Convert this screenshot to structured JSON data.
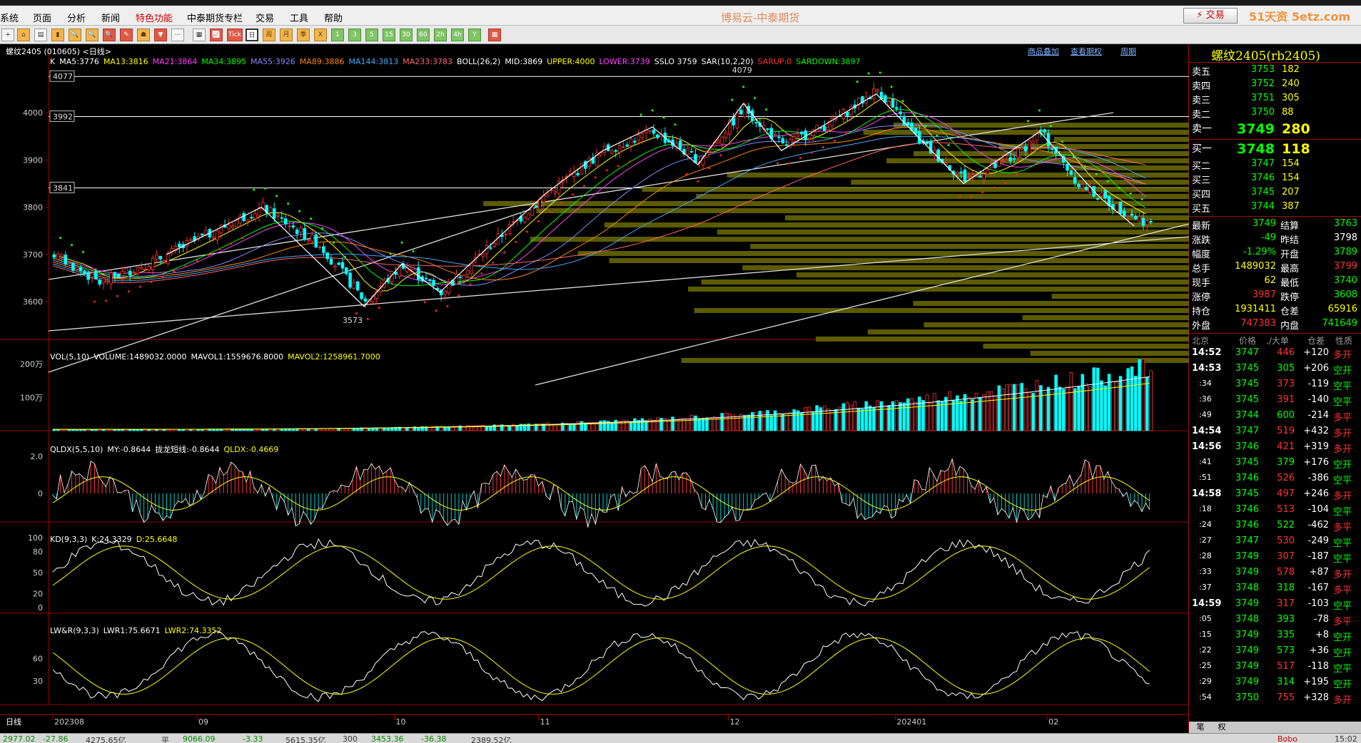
{
  "menu": [
    "系统",
    "页面",
    "分析",
    "新闻",
    "特色功能",
    "中泰期货专栏",
    "交易",
    "工具",
    "帮助"
  ],
  "app_title": "博易云-中泰期货",
  "trade_button": "⚡ 交易",
  "watermark": "51天资 5etz.com",
  "toolbar_labels": [
    "+",
    "⌂",
    "▤",
    "▮",
    "🔍",
    "🔍",
    "🔍",
    "✎",
    "☗",
    "▼",
    "⋯",
    "▦",
    "📈",
    "Tick",
    "日",
    "周",
    "月",
    "季",
    "X",
    "1",
    "3",
    "5",
    "15",
    "30",
    "60",
    "2h",
    "4h",
    "Y",
    "▦"
  ],
  "chart": {
    "instrument_label": "螺纹2405 (010605) <日线>",
    "links": [
      "商品叠加",
      "查看期权",
      "周期"
    ],
    "ma_legend": [
      {
        "text": "K",
        "color": "#ffffff"
      },
      {
        "text": "MA5:3776",
        "color": "#ffffff"
      },
      {
        "text": "MA13:3816",
        "color": "#ffff00"
      },
      {
        "text": "MA21:3864",
        "color": "#ff44ff"
      },
      {
        "text": "MA34:3895",
        "color": "#00ff00"
      },
      {
        "text": "MA55:3926",
        "color": "#8888ff"
      },
      {
        "text": "MA89:3886",
        "color": "#ff8800"
      },
      {
        "text": "MA144:3813",
        "color": "#44aaff"
      },
      {
        "text": "MA233:3783",
        "color": "#ff6666"
      },
      {
        "text": "BOLL(26,2)",
        "color": "#ffffff"
      },
      {
        "text": "MID:3869",
        "color": "#ffffff"
      },
      {
        "text": "UPPER:4000",
        "color": "#ffff00"
      },
      {
        "text": "LOWER:3739",
        "color": "#ff44ff"
      },
      {
        "text": "SSLO 3759",
        "color": "#ffffff"
      },
      {
        "text": "SAR(10,2,20)",
        "color": "#ffffff"
      },
      {
        "text": "SARUP:0",
        "color": "#ff3333"
      },
      {
        "text": "SARDOWN:3897",
        "color": "#00ff00"
      }
    ],
    "price_axis": [
      "4000",
      "3900",
      "3800",
      "3700",
      "3600"
    ],
    "price_boxes": [
      "4077",
      "3992",
      "3841"
    ],
    "annotations": [
      "4079",
      "3573"
    ],
    "vol_legend": [
      {
        "text": "VOL(5,10)",
        "color": "#ffffff"
      },
      {
        "text": "VOLUME:1489032.0000",
        "color": "#ffffff"
      },
      {
        "text": "MAVOL1:1559676.8000",
        "color": "#ffffff"
      },
      {
        "text": "MAVOL2:1258961.7000",
        "color": "#ffff00"
      }
    ],
    "vol_axis": [
      "200万",
      "100万"
    ],
    "qldx_legend": [
      {
        "text": "QLDX(5,5,10)",
        "color": "#ffffff"
      },
      {
        "text": "MY:-0.8644",
        "color": "#ffffff"
      },
      {
        "text": "拢龙短线:-0.8644",
        "color": "#ffffff"
      },
      {
        "text": "QLDX:-0.4669",
        "color": "#ffff00"
      }
    ],
    "qldx_axis": [
      "2.0",
      "0"
    ],
    "kd_legend": [
      {
        "text": "KD(9,3,3)",
        "color": "#ffffff"
      },
      {
        "text": "K:24.3329",
        "color": "#ffffff"
      },
      {
        "text": "D:25.6648",
        "color": "#ffff00"
      }
    ],
    "kd_axis": [
      "100",
      "80",
      "50",
      "20",
      "0"
    ],
    "lwr_legend": [
      {
        "text": "LW&R(9,3,3)",
        "color": "#ffffff"
      },
      {
        "text": "LWR1:75.6671",
        "color": "#ffffff"
      },
      {
        "text": "LWR2:74.3352",
        "color": "#ffff00"
      }
    ],
    "lwr_axis": [
      "60",
      "30"
    ],
    "x_axis_label": "日线",
    "x_axis": [
      "202308",
      "09",
      "10",
      "11",
      "12",
      "202401",
      "02"
    ]
  },
  "quote": {
    "title": "螺纹2405(rb2405)",
    "asks": [
      {
        "label": "卖五",
        "price": "3753",
        "vol": "182"
      },
      {
        "label": "卖四",
        "price": "3752",
        "vol": "240"
      },
      {
        "label": "卖三",
        "price": "3751",
        "vol": "305"
      },
      {
        "label": "卖二",
        "price": "3750",
        "vol": "88"
      },
      {
        "label": "卖一",
        "price": "3749",
        "vol": "280"
      }
    ],
    "bids": [
      {
        "label": "买一",
        "price": "3748",
        "vol": "118"
      },
      {
        "label": "买二",
        "price": "3747",
        "vol": "154"
      },
      {
        "label": "买三",
        "price": "3746",
        "vol": "154"
      },
      {
        "label": "买四",
        "price": "3745",
        "vol": "207"
      },
      {
        "label": "买五",
        "price": "3744",
        "vol": "387"
      }
    ],
    "stats": [
      {
        "l1": "最新",
        "v1": "3749",
        "c1": "#00ff00",
        "l2": "结算",
        "v2": "3763",
        "c2": "#00ff00"
      },
      {
        "l1": "涨跌",
        "v1": "-49",
        "c1": "#00ff00",
        "l2": "昨结",
        "v2": "3798",
        "c2": "#ffffff"
      },
      {
        "l1": "幅度",
        "v1": "-1.29%",
        "c1": "#00ff00",
        "l2": "开盘",
        "v2": "3789",
        "c2": "#00ff00"
      },
      {
        "l1": "总手",
        "v1": "1489032",
        "c1": "#ffff00",
        "l2": "最高",
        "v2": "3799",
        "c2": "#ff3333"
      },
      {
        "l1": "现手",
        "v1": "62",
        "c1": "#ffff00",
        "l2": "最低",
        "v2": "3740",
        "c2": "#00ff00"
      },
      {
        "l1": "涨停",
        "v1": "3987",
        "c1": "#ff3333",
        "l2": "跌停",
        "v2": "3608",
        "c2": "#00ff00"
      },
      {
        "l1": "持仓",
        "v1": "1931411",
        "c1": "#ffff00",
        "l2": "仓差",
        "v2": "65916",
        "c2": "#ffff00"
      },
      {
        "l1": "外盘",
        "v1": "747383",
        "c1": "#ff3333",
        "l2": "内盘",
        "v2": "741649",
        "c2": "#00ff00"
      }
    ],
    "tick_header": [
      "北京",
      "价格",
      "./大单",
      "仓差",
      "性质"
    ],
    "ticks": [
      {
        "time": "14:52",
        "price": "3747",
        "vol": "446",
        "oi": "+120",
        "nature": "多开",
        "bold": true
      },
      {
        "time": "14:53",
        "price": "3745",
        "vol": "305",
        "oi": "+206",
        "nature": "空开",
        "bold": true
      },
      {
        "time": ":34",
        "price": "3745",
        "vol": "373",
        "oi": "-119",
        "nature": "空平",
        "bold": false
      },
      {
        "time": ":36",
        "price": "3745",
        "vol": "391",
        "oi": "-140",
        "nature": "空平",
        "bold": false
      },
      {
        "time": ":49",
        "price": "3744",
        "vol": "600",
        "oi": "-214",
        "nature": "多平",
        "bold": false
      },
      {
        "time": "14:54",
        "price": "3747",
        "vol": "519",
        "oi": "+432",
        "nature": "多开",
        "bold": true
      },
      {
        "time": "14:56",
        "price": "3746",
        "vol": "421",
        "oi": "+319",
        "nature": "多开",
        "bold": true
      },
      {
        "time": ":41",
        "price": "3745",
        "vol": "379",
        "oi": "+176",
        "nature": "空开",
        "bold": false
      },
      {
        "time": ":51",
        "price": "3746",
        "vol": "526",
        "oi": "-386",
        "nature": "空平",
        "bold": false
      },
      {
        "time": "14:58",
        "price": "3745",
        "vol": "497",
        "oi": "+246",
        "nature": "多开",
        "bold": true
      },
      {
        "time": ":18",
        "price": "3746",
        "vol": "513",
        "oi": "-104",
        "nature": "空平",
        "bold": false
      },
      {
        "time": ":24",
        "price": "3746",
        "vol": "522",
        "oi": "-462",
        "nature": "多平",
        "bold": false
      },
      {
        "time": ":27",
        "price": "3747",
        "vol": "530",
        "oi": "-249",
        "nature": "空平",
        "bold": false
      },
      {
        "time": ":28",
        "price": "3749",
        "vol": "307",
        "oi": "-187",
        "nature": "空平",
        "bold": false
      },
      {
        "time": ":33",
        "price": "3749",
        "vol": "578",
        "oi": "+87",
        "nature": "多开",
        "bold": false
      },
      {
        "time": ":37",
        "price": "3748",
        "vol": "318",
        "oi": "-167",
        "nature": "多平",
        "bold": false
      },
      {
        "time": "14:59",
        "price": "3749",
        "vol": "317",
        "oi": "-103",
        "nature": "空平",
        "bold": true
      },
      {
        "time": ":05",
        "price": "3748",
        "vol": "393",
        "oi": "-78",
        "nature": "多平",
        "bold": false
      },
      {
        "time": ":15",
        "price": "3749",
        "vol": "335",
        "oi": "+8",
        "nature": "空开",
        "bold": false
      },
      {
        "time": ":22",
        "price": "3749",
        "vol": "573",
        "oi": "+36",
        "nature": "空开",
        "bold": false
      },
      {
        "time": ":25",
        "price": "3749",
        "vol": "517",
        "oi": "-118",
        "nature": "空平",
        "bold": false
      },
      {
        "time": ":29",
        "price": "3749",
        "vol": "314",
        "oi": "+195",
        "nature": "空开",
        "bold": false
      },
      {
        "time": ":54",
        "price": "3750",
        "vol": "755",
        "oi": "+328",
        "nature": "多开",
        "bold": false
      }
    ],
    "tabs": [
      "笔",
      "权"
    ]
  },
  "status": [
    {
      "text": "2977.02",
      "color": "#008800"
    },
    {
      "text": "-27.86",
      "color": "#008800"
    },
    {
      "text": "4275.65亿",
      "color": "#333333"
    },
    {
      "text": "平",
      "color": "#333333"
    },
    {
      "text": "9066.09",
      "color": "#008800"
    },
    {
      "text": "-3.33",
      "color": "#008800"
    },
    {
      "text": "5615.35亿",
      "color": "#333333"
    },
    {
      "text": "300",
      "color": "#333333"
    },
    {
      "text": "3453.36",
      "color": "#008800"
    },
    {
      "text": "-36.38",
      "color": "#008800"
    },
    {
      "text": "2389.52亿",
      "color": "#333333"
    },
    {
      "text": "Bobo",
      "color": "#cc0000"
    },
    {
      "text": "15:02",
      "color": "#333333"
    }
  ]
}
